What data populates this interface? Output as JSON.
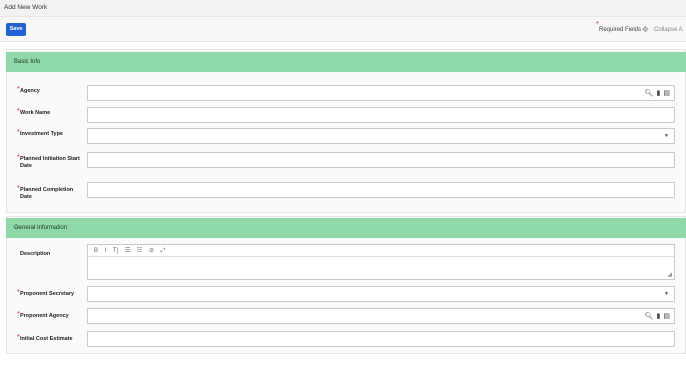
{
  "window": {
    "title": "Add New Work"
  },
  "toolbar": {
    "save_label": "Save",
    "required_star": "*",
    "required_label": "Required Fields",
    "collapse_label": "Collapse A"
  },
  "basic_info": {
    "title": "Basic Info",
    "fields": [
      {
        "label": "Agency",
        "required": true
      },
      {
        "label": "Work Name",
        "required": true
      },
      {
        "label": "Investment Type",
        "required": true
      },
      {
        "label": "Planned Initiation Start Date",
        "required": true
      },
      {
        "label": "Planned Completion Date",
        "required": true
      }
    ]
  },
  "general_info": {
    "title": "General Information",
    "fields": [
      {
        "label": "Description",
        "required": false
      },
      {
        "label": "Proponent Secretary",
        "required": true
      },
      {
        "label": "Proponent Agency",
        "required": true
      },
      {
        "label": "Initial Cost Estimate",
        "required": true
      }
    ],
    "editor_tools": [
      "B",
      "I",
      "T|",
      "☰",
      "☷",
      "⊘",
      "⤢"
    ]
  },
  "icons": {
    "search": "search-icon",
    "bookmark": "bookmark-icon",
    "table": "table-icon",
    "dropdown": "chevron-down-icon"
  }
}
